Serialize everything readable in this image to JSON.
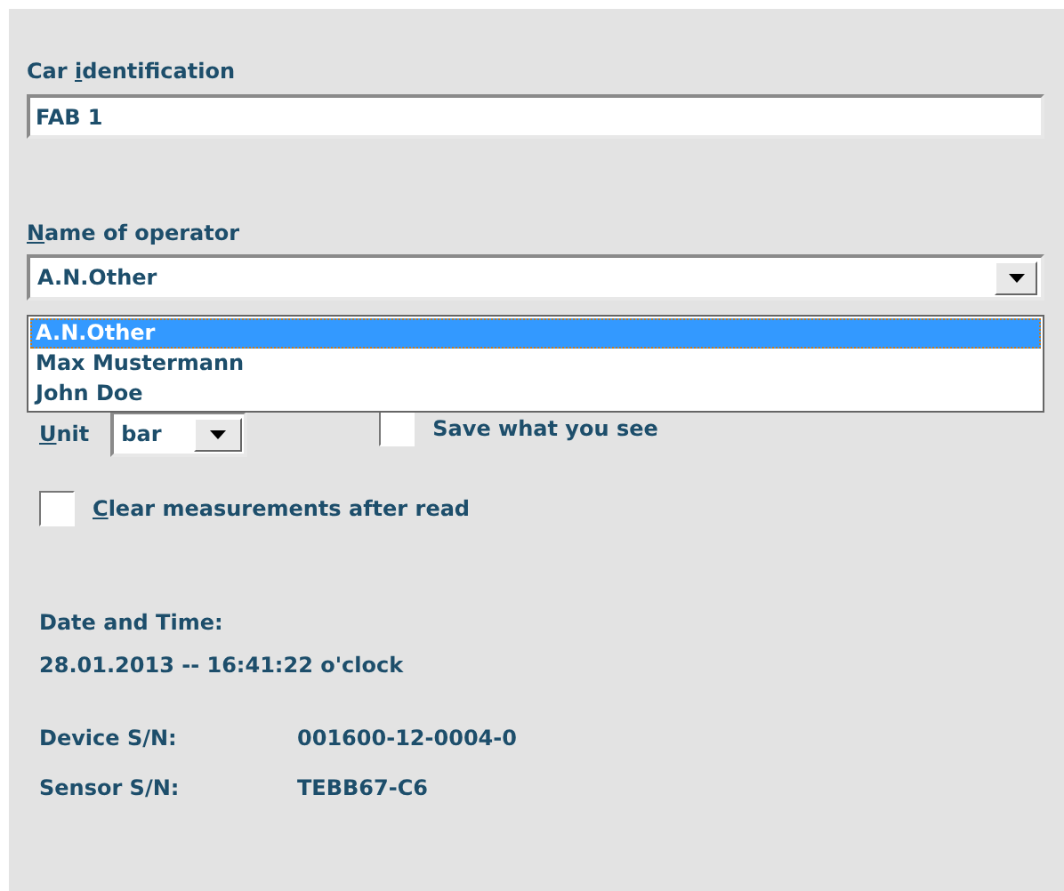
{
  "car_identification": {
    "label": {
      "before": "Car ",
      "key": "i",
      "after": "dentification"
    },
    "value": "FAB 1"
  },
  "operator": {
    "label": {
      "key": "N",
      "after": "ame of operator"
    },
    "value": "A.N.Other",
    "expanded": true,
    "options": [
      {
        "label": "A.N.Other",
        "selected": true
      },
      {
        "label": "Max Mustermann",
        "selected": false
      },
      {
        "label": "John Doe",
        "selected": false
      }
    ]
  },
  "unit": {
    "label": {
      "key": "U",
      "after": "nit"
    },
    "value": "bar"
  },
  "save_what_you_see": {
    "label": {
      "before": "Save what you see"
    },
    "checked": false
  },
  "clear_measurements": {
    "label": {
      "key": "C",
      "after": "lear measurements after read"
    },
    "checked": false
  },
  "date_time": {
    "label": "Date and Time:",
    "value": "28.01.2013 -- 16:41:22 o'clock"
  },
  "serials": [
    {
      "label": "Device S/N:",
      "value": "001600-12-0004-0"
    },
    {
      "label": "Sensor S/N:",
      "value": "TEBB67-C6"
    }
  ]
}
